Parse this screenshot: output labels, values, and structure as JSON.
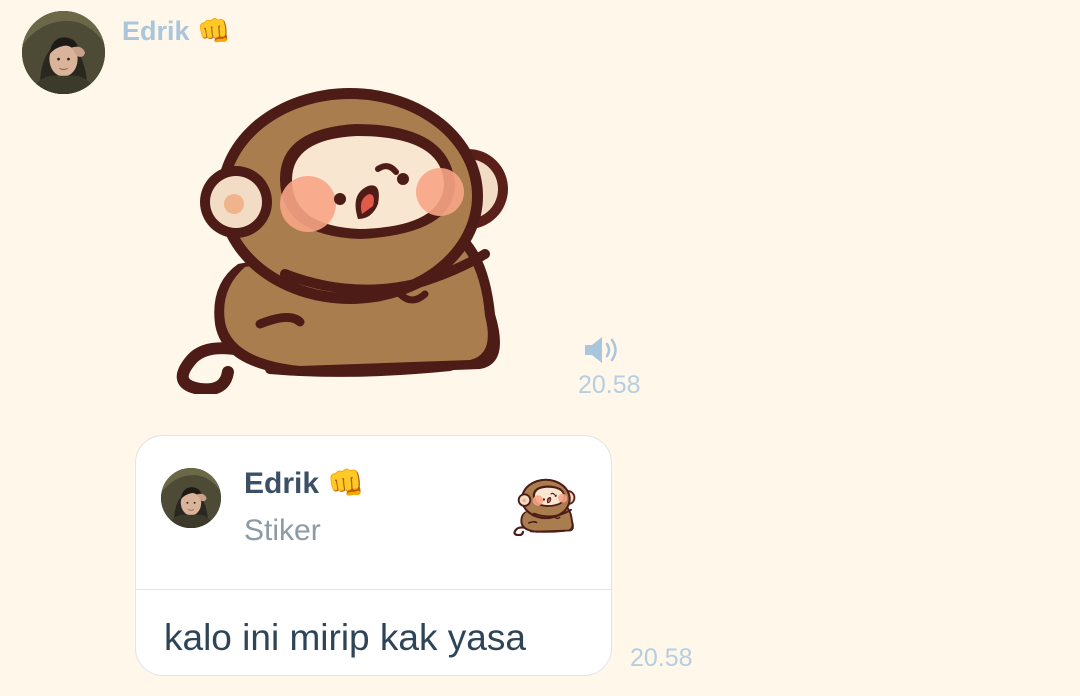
{
  "message1": {
    "sender_name": "Edrik",
    "sender_emoji": "👊",
    "avatar_icon": "profile-photo",
    "sticker_icon": "monkey-sticker",
    "audio_icon": "speaker-icon",
    "timestamp": "20.58"
  },
  "message2": {
    "quote": {
      "sender_name": "Edrik",
      "sender_emoji": "👊",
      "type_label": "Stiker",
      "thumb_icon": "monkey-sticker-thumbnail"
    },
    "text": "kalo ini mirip kak yasa",
    "timestamp": "20.58"
  },
  "colors": {
    "background": "#fef7ea",
    "sender_name": "#a9c6dc",
    "timestamp": "#b5cfe0",
    "bubble": "#ffffff",
    "message_text": "#2e4457"
  }
}
